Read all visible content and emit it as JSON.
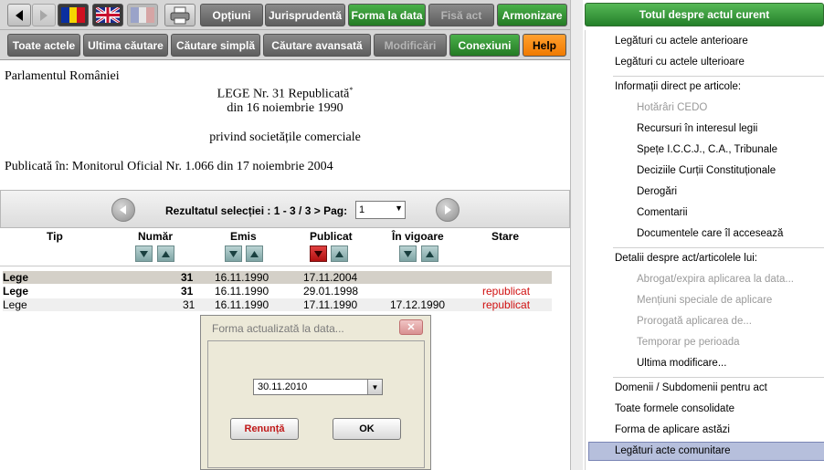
{
  "toolbar1": {
    "buttons": {
      "optiuni": "Opțiuni",
      "jurisprudenta": "Jurisprudentă",
      "forma_la_data": "Forma la data",
      "fisa_act": "Fisă act",
      "armonizare": "Armonizare"
    }
  },
  "toolbar2": {
    "buttons": {
      "toate_actele": "Toate actele",
      "ultima_cautare": "Ultima căutare",
      "cautare_simpla": "Căutare simplă",
      "cautare_avansata": "Căutare avansată",
      "modificari": "Modificări",
      "conexiuni": "Conexiuni",
      "help": "Help"
    }
  },
  "document": {
    "issuer": "Parlamentul României",
    "title": "LEGE Nr. 31 Republicată",
    "title_mark": "*",
    "date": "din 16 noiembrie 1990",
    "subject": "privind societățile comerciale",
    "published": "Publicată în: Monitorul Oficial Nr. 1.066 din 17 noiembrie 2004"
  },
  "results": {
    "info": "Rezultatul selecției : 1 - 3 / 3 > Pag:",
    "page": "1",
    "columns": {
      "tip": "Tip",
      "numar": "Număr",
      "emis": "Emis",
      "publicat": "Publicat",
      "in_vigoare": "În vigoare",
      "stare": "Stare"
    },
    "rows": [
      {
        "tip": "Lege",
        "numar": "31",
        "emis": "16.11.1990",
        "publicat": "17.11.2004",
        "in_vigoare": "",
        "stare": ""
      },
      {
        "tip": "Lege",
        "numar": "31",
        "emis": "16.11.1990",
        "publicat": "29.01.1998",
        "in_vigoare": "",
        "stare": "republicat"
      },
      {
        "tip": "Lege",
        "numar": "31",
        "emis": "16.11.1990",
        "publicat": "17.11.1990",
        "in_vigoare": "17.12.1990",
        "stare": "republicat"
      }
    ]
  },
  "dialog": {
    "title": "Forma actualizată la data...",
    "date_value": "30.11.2010",
    "cancel": "Renunță",
    "ok": "OK"
  },
  "right_panel": {
    "header": "Totul despre actul curent",
    "items": {
      "legaturi_anterioare": "Legături cu actele anterioare",
      "legaturi_ulterioare": "Legături cu actele ulterioare",
      "informatii_articole": "Informații direct pe articole:",
      "hotarari_cedo": "Hotărâri CEDO",
      "recursuri": "Recursuri în interesul legii",
      "spete": "Spețe I.C.C.J., C.A., Tribunale",
      "decizii_cc": "Deciziile Curții Constituționale",
      "derogari": "Derogări",
      "comentarii": "Comentarii",
      "documente_acceseaza": "Documentele care îl accesează",
      "detalii": "Detalii despre act/articolele lui:",
      "abrogat": "Abrogat/expira aplicarea la data...",
      "mentiuni": "Mențiuni speciale de aplicare",
      "prorogata": "Prorogată aplicarea de...",
      "temporar": "Temporar pe perioada",
      "ultima_modificare": "Ultima modificare...",
      "domenii": "Domenii / Subdomenii pentru act",
      "formele_consolidate": "Toate formele consolidate",
      "forma_aplicare": "Forma de aplicare astăzi",
      "legaturi_comunitare": "Legături acte comunitare"
    }
  },
  "colors": {
    "green_button": "#2f8f2f",
    "gray_button": "#6f6f6f",
    "help_button": "#f58a10",
    "status_red": "#d01010",
    "selected_row": "#d4d0c8",
    "panel_selected": "#b6bfdc"
  }
}
